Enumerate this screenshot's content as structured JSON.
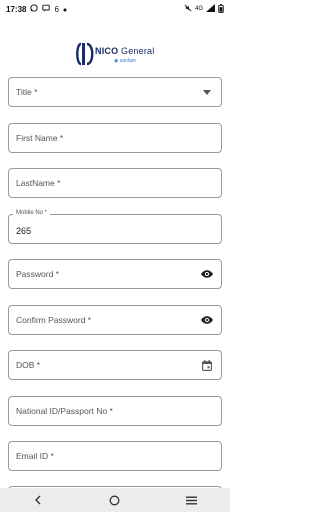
{
  "status_bar": {
    "time": "17:38",
    "notification_count": "6",
    "network": "4G",
    "icons": [
      "whatsapp-icon",
      "messages-icon",
      "dot-icon",
      "mute-icon",
      "signal-icon",
      "battery-icon"
    ]
  },
  "logo": {
    "brand_bold": "NICO",
    "brand_rest": " General",
    "sub": "sanlam"
  },
  "form": {
    "title": {
      "label": "Title *",
      "icon": "dropdown-arrow-icon"
    },
    "first_name": {
      "label": "First Name *"
    },
    "last_name": {
      "label": "LastName *"
    },
    "mobile": {
      "label": "Mobile No *",
      "value": "265"
    },
    "password": {
      "label": "Password *",
      "icon": "eye-icon"
    },
    "confirm_password": {
      "label": "Confirm Password *",
      "icon": "eye-icon"
    },
    "dob": {
      "label": "DOB *",
      "icon": "calendar-icon"
    },
    "national_id": {
      "label": "National ID/Passport No *"
    },
    "email": {
      "label": "Email ID *"
    }
  },
  "nav": {
    "buttons": [
      "back-icon",
      "home-icon",
      "recents-icon"
    ]
  }
}
